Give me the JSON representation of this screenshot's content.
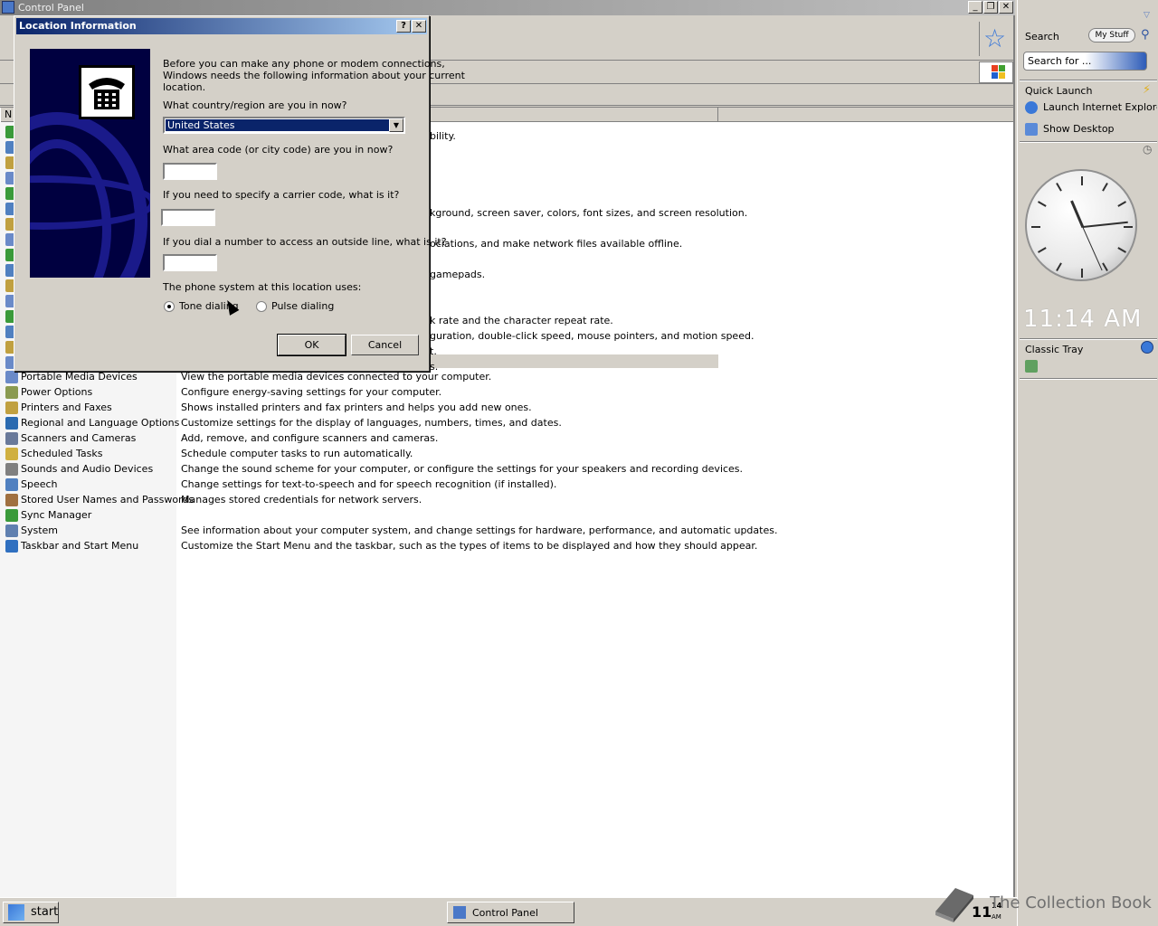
{
  "window": {
    "title": "Control Panel"
  },
  "columns": {
    "name": "N"
  },
  "items": [
    {
      "name": "Portable Media Devices",
      "desc": "View the portable media devices connected to your computer.",
      "color": "#6a8ac8"
    },
    {
      "name": "Power Options",
      "desc": "Configure energy-saving settings for your computer.",
      "color": "#8a9a50"
    },
    {
      "name": "Printers and Faxes",
      "desc": "Shows installed printers and fax printers and helps you add new ones.",
      "color": "#c0a040"
    },
    {
      "name": "Regional and Language Options",
      "desc": "Customize settings for the display of languages, numbers, times, and dates.",
      "color": "#2a6ab0"
    },
    {
      "name": "Scanners and Cameras",
      "desc": "Add, remove, and configure scanners and cameras.",
      "color": "#6a7a9a"
    },
    {
      "name": "Scheduled Tasks",
      "desc": "Schedule computer tasks to run automatically.",
      "color": "#d0b040"
    },
    {
      "name": "Sounds and Audio Devices",
      "desc": "Change the sound scheme for your computer, or configure the settings for your speakers and recording devices.",
      "color": "#808080"
    },
    {
      "name": "Speech",
      "desc": "Change settings for text-to-speech and for speech recognition (if installed).",
      "color": "#5080c0"
    },
    {
      "name": "Stored User Names and Passwords",
      "desc": "Manages stored credentials for network servers.",
      "color": "#a07040"
    },
    {
      "name": "Sync Manager",
      "desc": "",
      "color": "#3a9a3a"
    },
    {
      "name": "System",
      "desc": "See information about your computer system, and change settings for hardware, performance, and automatic updates.",
      "color": "#6080b0"
    },
    {
      "name": "Taskbar and Start Menu",
      "desc": "Customize the Start Menu and the taskbar, such as the types of items to be displayed and how they should appear.",
      "color": "#3070c0"
    }
  ],
  "partial_desc": [
    {
      "text": "bility.",
      "top": 0
    },
    {
      "text": "kground, screen saver, colors, font sizes, and screen resolution.",
      "top": 0
    },
    {
      "text": "ociations, and make network files available offline.",
      "top": 0
    },
    {
      "text": "gamepads.",
      "top": 0
    },
    {
      "text": "k rate and the character repeat rate.",
      "top": 0
    },
    {
      "text": "guration, double-click speed, mouse pointers, and motion speed.",
      "top": 0
    },
    {
      "text": "t.",
      "top": 0
    },
    {
      "text": "s.",
      "top": 0
    }
  ],
  "dialog": {
    "title": "Location Information",
    "help_button": "?",
    "close_button": "✕",
    "intro": "Before you can make any phone or modem connections,",
    "intro2": "Windows needs the following information about your current",
    "intro3": "location.",
    "country_label": "What country/region are you in now?",
    "country_value": "United States",
    "area_label": "What area code (or city code) are you in now?",
    "area_value": "",
    "carrier_label": "If you need to specify a carrier code, what is it?",
    "carrier_value": "",
    "outside_label": "If you dial a number to access an outside line, what is it?",
    "outside_value": "",
    "phone_system_label": "The phone system at this location uses:",
    "tone_label": "Tone dialing",
    "pulse_label": "Pulse dialing",
    "tone_selected": true,
    "ok": "OK",
    "cancel": "Cancel"
  },
  "sidebar": {
    "search_label": "Search",
    "mystuff": "My Stuff",
    "search_placeholder": "Search for ...",
    "quick_launch": "Quick Launch",
    "launch_ie": "Launch Internet Explorer Browser",
    "show_desktop": "Show Desktop",
    "clock_time": "11:14 AM",
    "classic_tray": "Classic Tray"
  },
  "taskbar": {
    "start": "start",
    "task_control_panel": "Control Panel",
    "time_hour": "11",
    "time_min": "14",
    "time_ampm": "AM"
  },
  "watermark": "The Collection Book",
  "clock": {
    "hour": 11,
    "minute": 14,
    "second": 26
  }
}
